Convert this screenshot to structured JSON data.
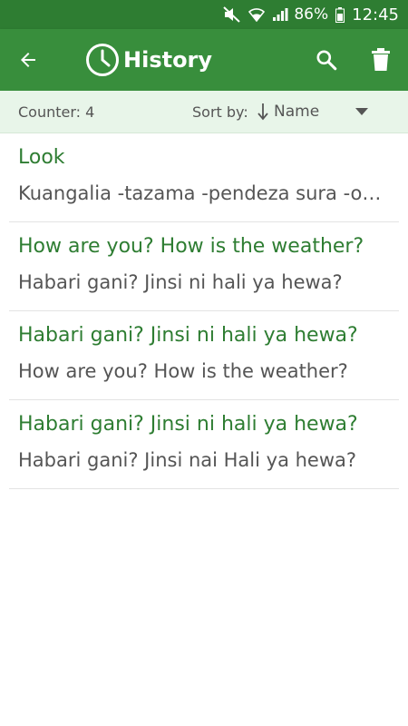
{
  "status_bar": {
    "battery": "86%",
    "time": "12:45"
  },
  "app_bar": {
    "title": "History"
  },
  "toolbar": {
    "counter": "Counter: 4",
    "sort_label": "Sort by:",
    "sort_value": "Name"
  },
  "history": [
    {
      "source": "Look",
      "translation": "Kuangalia  -tazama -pendeza sura -onekana"
    },
    {
      "source": "How are you? How is the weather?",
      "translation": "Habari gani? Jinsi ni hali ya hewa?"
    },
    {
      "source": "Habari gani? Jinsi ni hali ya hewa?",
      "translation": "How are you? How is the weather?"
    },
    {
      "source": "Habari gani? Jinsi ni hali ya hewa?",
      "translation": "Habari gani? Jinsi nai Hali ya hewa?"
    }
  ],
  "colors": {
    "status_bar": "#2e7d32",
    "app_bar": "#388e3c",
    "accent_text": "#2e7d32",
    "toolbar_bg": "#e8f5e9"
  }
}
